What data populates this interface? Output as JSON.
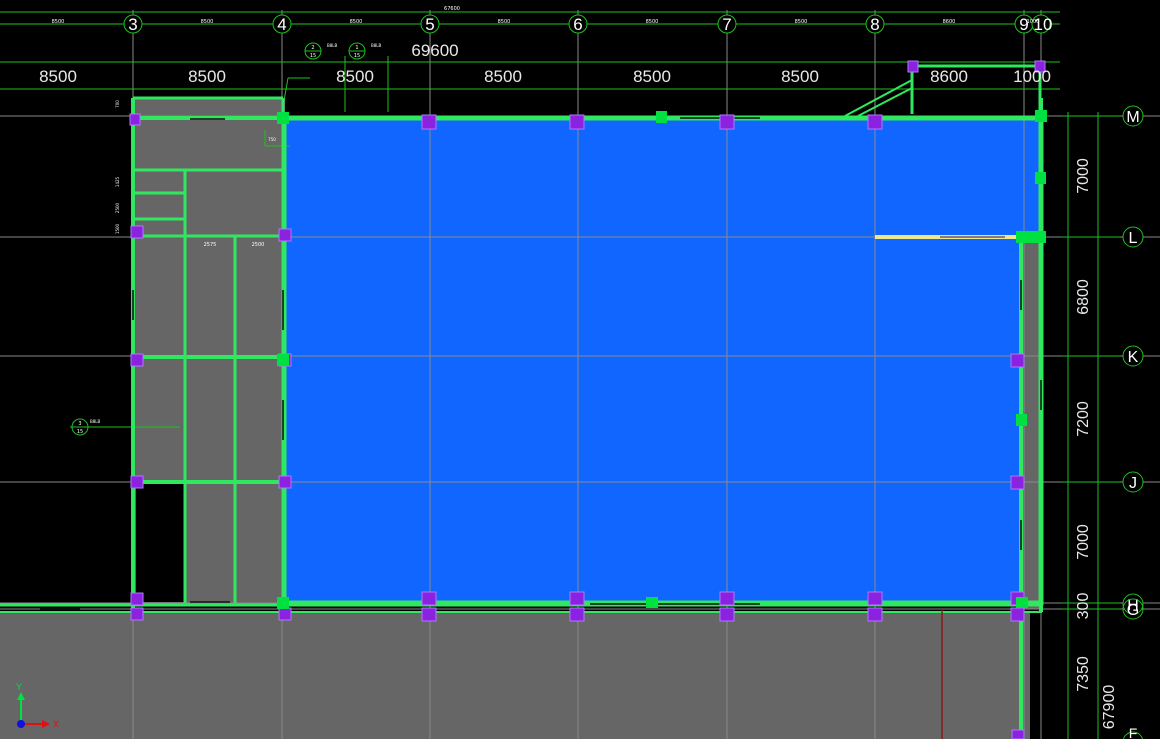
{
  "grid_columns": [
    "3",
    "4",
    "5",
    "6",
    "7",
    "8",
    "9",
    "10"
  ],
  "grid_rows": [
    "M",
    "L",
    "K",
    "J",
    "H",
    "G",
    "F"
  ],
  "top_total_small": "67600",
  "top_small_dims": [
    "8500",
    "8500",
    "8500",
    "8500",
    "8500",
    "8500",
    "8600",
    "1000"
  ],
  "top_total_large": "69600",
  "top_large_dims": [
    "8500",
    "8500",
    "8500",
    "8500",
    "8500",
    "8500",
    "8500",
    "8600",
    "1000"
  ],
  "right_dims": [
    "7000",
    "6800",
    "7200",
    "7000",
    "300",
    "7350"
  ],
  "right_total": "67900",
  "section_markers": [
    {
      "num": "2",
      "sheet": "15",
      "tag": "B8LB"
    },
    {
      "num": "1",
      "sheet": "15",
      "tag": "B8LB"
    },
    {
      "num": "3",
      "sheet": "15",
      "tag": "B8LB"
    }
  ],
  "inner_labels": [
    "2575",
    "2500",
    "1425",
    "2500",
    "1500",
    "700",
    "750"
  ],
  "axis": {
    "y": "Y",
    "x": "X"
  },
  "colors": {
    "slab": "#1066ff",
    "wall": "#30e860",
    "column": "#8a22e0",
    "grid": "#8a8a8a",
    "dim": "#1ec01e",
    "fill": "#666666"
  }
}
